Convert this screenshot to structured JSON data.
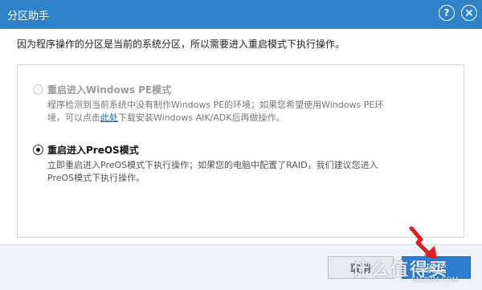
{
  "window": {
    "title": "分区助手",
    "help_icon": "question-circle-icon",
    "close_icon": "close-circle-icon",
    "title_bar_color": "#2e82c8"
  },
  "message": "因为程序操作的分区是当前的系统分区，所以需要进入重启模式下执行操作。",
  "options": [
    {
      "label": "重启进入Windows PE模式",
      "enabled": false,
      "selected": false,
      "desc_part1": "程序检测到当前系统中没有制作Windows PE的环境；如果您希望使用Windows PE环境，可以点击",
      "desc_link": "此处",
      "desc_part2": "下载安装Windows AIK/ADK后再做操作。"
    },
    {
      "label": "重启进入PreOS模式",
      "enabled": true,
      "selected": true,
      "desc": "立即重启进入PreOS模式下执行操作；如果您的电脑中配置了RAID，我们建议您进入PreOS模式下执行操作。"
    }
  ],
  "buttons": {
    "cancel": "取消",
    "ok": "确定"
  },
  "overlay": {
    "arrow_icon": "red-arrow-icon",
    "arrow_color": "#e02020",
    "watermark": "什么值得买",
    "watermark_sub": "SMZDM.COM"
  }
}
